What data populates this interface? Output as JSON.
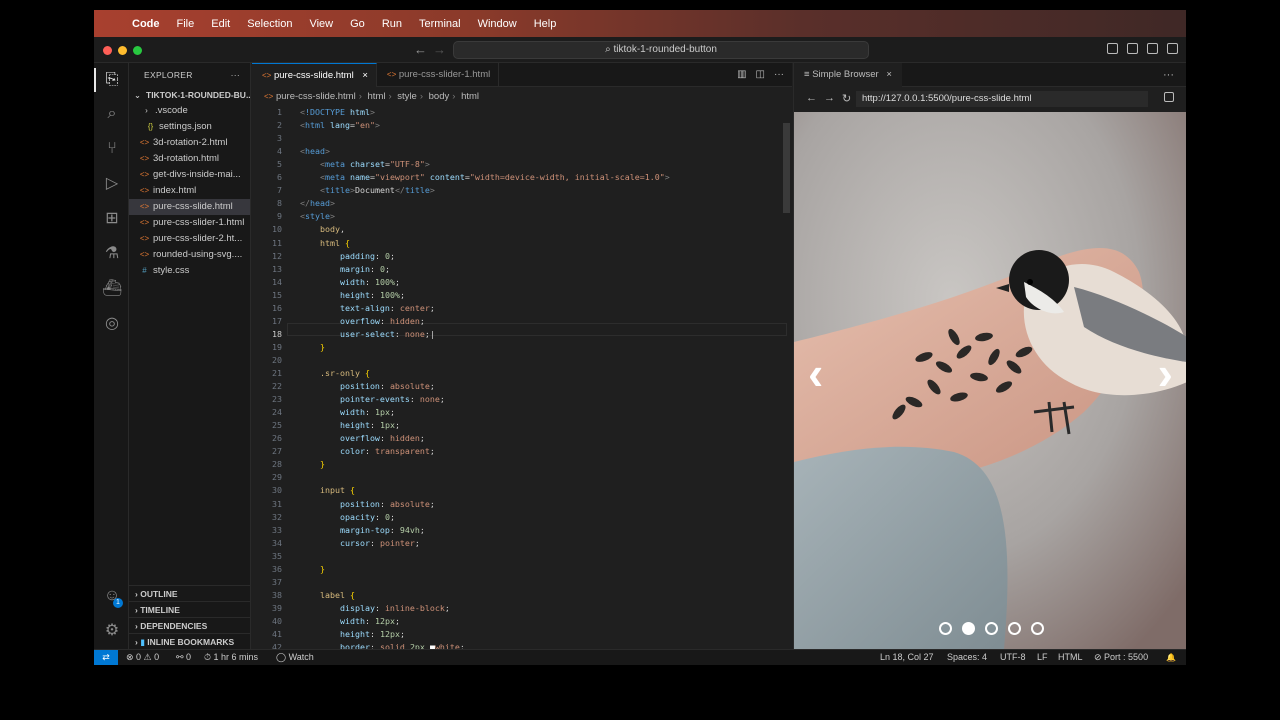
{
  "menubar": {
    "apple": "",
    "items": [
      "Code",
      "File",
      "Edit",
      "Selection",
      "View",
      "Go",
      "Run",
      "Terminal",
      "Window",
      "Help"
    ]
  },
  "titlebar": {
    "back": "←",
    "forward": "→",
    "search": "⌕ tiktok-1-rounded-button"
  },
  "activitybar": {
    "explorer": "⎘",
    "search": "⌕",
    "source_control": "⑂",
    "run": "▷",
    "extensions": "⊞",
    "testing": "⚗",
    "docker": "⛴",
    "remote": "◎",
    "accounts": "☺",
    "accounts_badge": "1",
    "settings": "⚙"
  },
  "sidebar": {
    "title": "EXPLORER",
    "more": "···",
    "root": "TIKTOK-1-ROUNDED-BU...",
    "files": [
      {
        "name": ".vscode",
        "icon": "›"
      },
      {
        "name": "settings.json",
        "icon": "{}"
      },
      {
        "name": "3d-rotation-2.html",
        "icon": "<>"
      },
      {
        "name": "3d-rotation.html",
        "icon": "<>"
      },
      {
        "name": "get-divs-inside-mai...",
        "icon": "<>"
      },
      {
        "name": "index.html",
        "icon": "<>"
      },
      {
        "name": "pure-css-slide.html",
        "icon": "<>"
      },
      {
        "name": "pure-css-slider-1.html",
        "icon": "<>"
      },
      {
        "name": "pure-css-slider-2.ht...",
        "icon": "<>"
      },
      {
        "name": "rounded-using-svg....",
        "icon": "<>"
      },
      {
        "name": "style.css",
        "icon": "#"
      }
    ],
    "sections": [
      "OUTLINE",
      "TIMELINE",
      "DEPENDENCIES",
      "INLINE BOOKMARKS"
    ]
  },
  "editor": {
    "tabs": [
      {
        "label": "pure-css-slide.html",
        "close": "×"
      },
      {
        "label": "pure-css-slider-1.html"
      }
    ],
    "tools": [
      "▥",
      "◫",
      "···"
    ],
    "breadcrumb": [
      "pure-css-slide.html",
      "html",
      "style",
      "body",
      "html"
    ],
    "lines": [
      {
        "n": "1",
        "html": "<span class='t-punc'>&lt;</span><span class='t-tag'>!DOCTYPE</span> <span class='t-attr'>html</span><span class='t-punc'>&gt;</span>"
      },
      {
        "n": "2",
        "html": "<span class='t-punc'>&lt;</span><span class='t-tag'>html</span> <span class='t-attr'>lang</span>=<span class='t-str'>\"en\"</span><span class='t-punc'>&gt;</span>"
      },
      {
        "n": "3",
        "html": ""
      },
      {
        "n": "4",
        "html": "<span class='t-punc'>&lt;</span><span class='t-tag'>head</span><span class='t-punc'>&gt;</span>"
      },
      {
        "n": "5",
        "html": "    <span class='t-punc'>&lt;</span><span class='t-tag'>meta</span> <span class='t-attr'>charset</span>=<span class='t-str'>\"UTF-8\"</span><span class='t-punc'>&gt;</span>"
      },
      {
        "n": "6",
        "html": "    <span class='t-punc'>&lt;</span><span class='t-tag'>meta</span> <span class='t-attr'>name</span>=<span class='t-str'>\"viewport\"</span> <span class='t-attr'>content</span>=<span class='t-str'>\"width=device-width, initial-scale=1.0\"</span><span class='t-punc'>&gt;</span>"
      },
      {
        "n": "7",
        "html": "    <span class='t-punc'>&lt;</span><span class='t-tag'>title</span><span class='t-punc'>&gt;</span>Document<span class='t-punc'>&lt;/</span><span class='t-tag'>title</span><span class='t-punc'>&gt;</span>"
      },
      {
        "n": "8",
        "html": "<span class='t-punc'>&lt;/</span><span class='t-tag'>head</span><span class='t-punc'>&gt;</span>"
      },
      {
        "n": "9",
        "html": "<span class='t-punc'>&lt;</span><span class='t-tag'>style</span><span class='t-punc'>&gt;</span>"
      },
      {
        "n": "10",
        "html": "    <span class='t-sel'>body</span>,"
      },
      {
        "n": "11",
        "html": "    <span class='t-sel'>html</span> <span class='t-br'>{</span>"
      },
      {
        "n": "12",
        "html": "        <span class='t-prop'>padding</span>: <span class='t-num'>0</span>;"
      },
      {
        "n": "13",
        "html": "        <span class='t-prop'>margin</span>: <span class='t-num'>0</span>;"
      },
      {
        "n": "14",
        "html": "        <span class='t-prop'>width</span>: <span class='t-num'>100%</span>;"
      },
      {
        "n": "15",
        "html": "        <span class='t-prop'>height</span>: <span class='t-num'>100%</span>;"
      },
      {
        "n": "16",
        "html": "        <span class='t-prop'>text-align</span>: <span class='t-val'>center</span>;"
      },
      {
        "n": "17",
        "html": "        <span class='t-prop'>overflow</span>: <span class='t-val'>hidden</span>;"
      },
      {
        "n": "18",
        "html": "        <span class='t-prop'>user-select</span>: <span class='t-val'>none</span>;|"
      },
      {
        "n": "19",
        "html": "    <span class='t-br'>}</span>"
      },
      {
        "n": "20",
        "html": ""
      },
      {
        "n": "21",
        "html": "    <span class='t-sel'>.sr-only</span> <span class='t-br'>{</span>"
      },
      {
        "n": "22",
        "html": "        <span class='t-prop'>position</span>: <span class='t-val'>absolute</span>;"
      },
      {
        "n": "23",
        "html": "        <span class='t-prop'>pointer-events</span>: <span class='t-val'>none</span>;"
      },
      {
        "n": "24",
        "html": "        <span class='t-prop'>width</span>: <span class='t-num'>1px</span>;"
      },
      {
        "n": "25",
        "html": "        <span class='t-prop'>height</span>: <span class='t-num'>1px</span>;"
      },
      {
        "n": "26",
        "html": "        <span class='t-prop'>overflow</span>: <span class='t-val'>hidden</span>;"
      },
      {
        "n": "27",
        "html": "        <span class='t-prop'>color</span>: <span class='t-val'>transparent</span>;"
      },
      {
        "n": "28",
        "html": "    <span class='t-br'>}</span>"
      },
      {
        "n": "29",
        "html": ""
      },
      {
        "n": "30",
        "html": "    <span class='t-sel'>input</span> <span class='t-br'>{</span>"
      },
      {
        "n": "31",
        "html": "        <span class='t-prop'>position</span>: <span class='t-val'>absolute</span>;"
      },
      {
        "n": "32",
        "html": "        <span class='t-prop'>opacity</span>: <span class='t-num'>0</span>;"
      },
      {
        "n": "33",
        "html": "        <span class='t-prop'>margin-top</span>: <span class='t-num'>94vh</span>;"
      },
      {
        "n": "34",
        "html": "        <span class='t-prop'>cursor</span>: <span class='t-val'>pointer</span>;"
      },
      {
        "n": "35",
        "html": ""
      },
      {
        "n": "36",
        "html": "    <span class='t-br'>}</span>"
      },
      {
        "n": "37",
        "html": ""
      },
      {
        "n": "38",
        "html": "    <span class='t-sel'>label</span> <span class='t-br'>{</span>"
      },
      {
        "n": "39",
        "html": "        <span class='t-prop'>display</span>: <span class='t-val'>inline-block</span>;"
      },
      {
        "n": "40",
        "html": "        <span class='t-prop'>width</span>: <span class='t-num'>12px</span>;"
      },
      {
        "n": "41",
        "html": "        <span class='t-prop'>height</span>: <span class='t-num'>12px</span>;"
      },
      {
        "n": "42",
        "html": "        <span class='t-prop'>border</span>: <span class='t-val'>solid</span> <span class='t-num'>2px</span> <span style='color:#fff'>■</span><span class='t-val'>white</span>;"
      }
    ]
  },
  "browser": {
    "tab_label": "Simple Browser",
    "tab_close": "×",
    "more": "···",
    "back": "←",
    "forward": "→",
    "reload": "↻",
    "url": "http://127.0.0.1:5500/pure-css-slide.html",
    "prev_arrow": "‹",
    "next_arrow": "›",
    "slide_dots": [
      false,
      true,
      false,
      false,
      false
    ]
  },
  "statusbar": {
    "remote": "⇄",
    "problems": "⊗ 0 ⚠ 0",
    "ports": "⚯ 0",
    "time": "⏱ 1 hr 6 mins",
    "watch": "◯ Watch",
    "position": "Ln 18, Col 27",
    "spaces": "Spaces: 4",
    "encoding": "UTF-8",
    "eol": "LF",
    "language": "HTML",
    "port": "⊘ Port : 5500",
    "bell": "🔔"
  }
}
